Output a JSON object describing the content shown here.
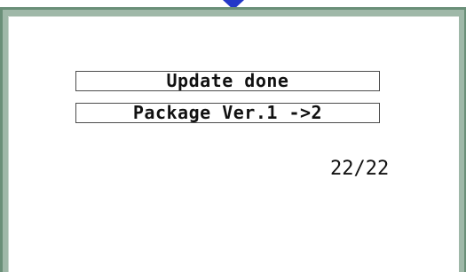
{
  "dialog": {
    "status_message": "Update done",
    "package_version": "Package Ver.1 ->2",
    "progress_counter": "22/22"
  },
  "colors": {
    "frame": "#9fb8a8",
    "pointer": "#2438c8",
    "text": "#111111"
  }
}
